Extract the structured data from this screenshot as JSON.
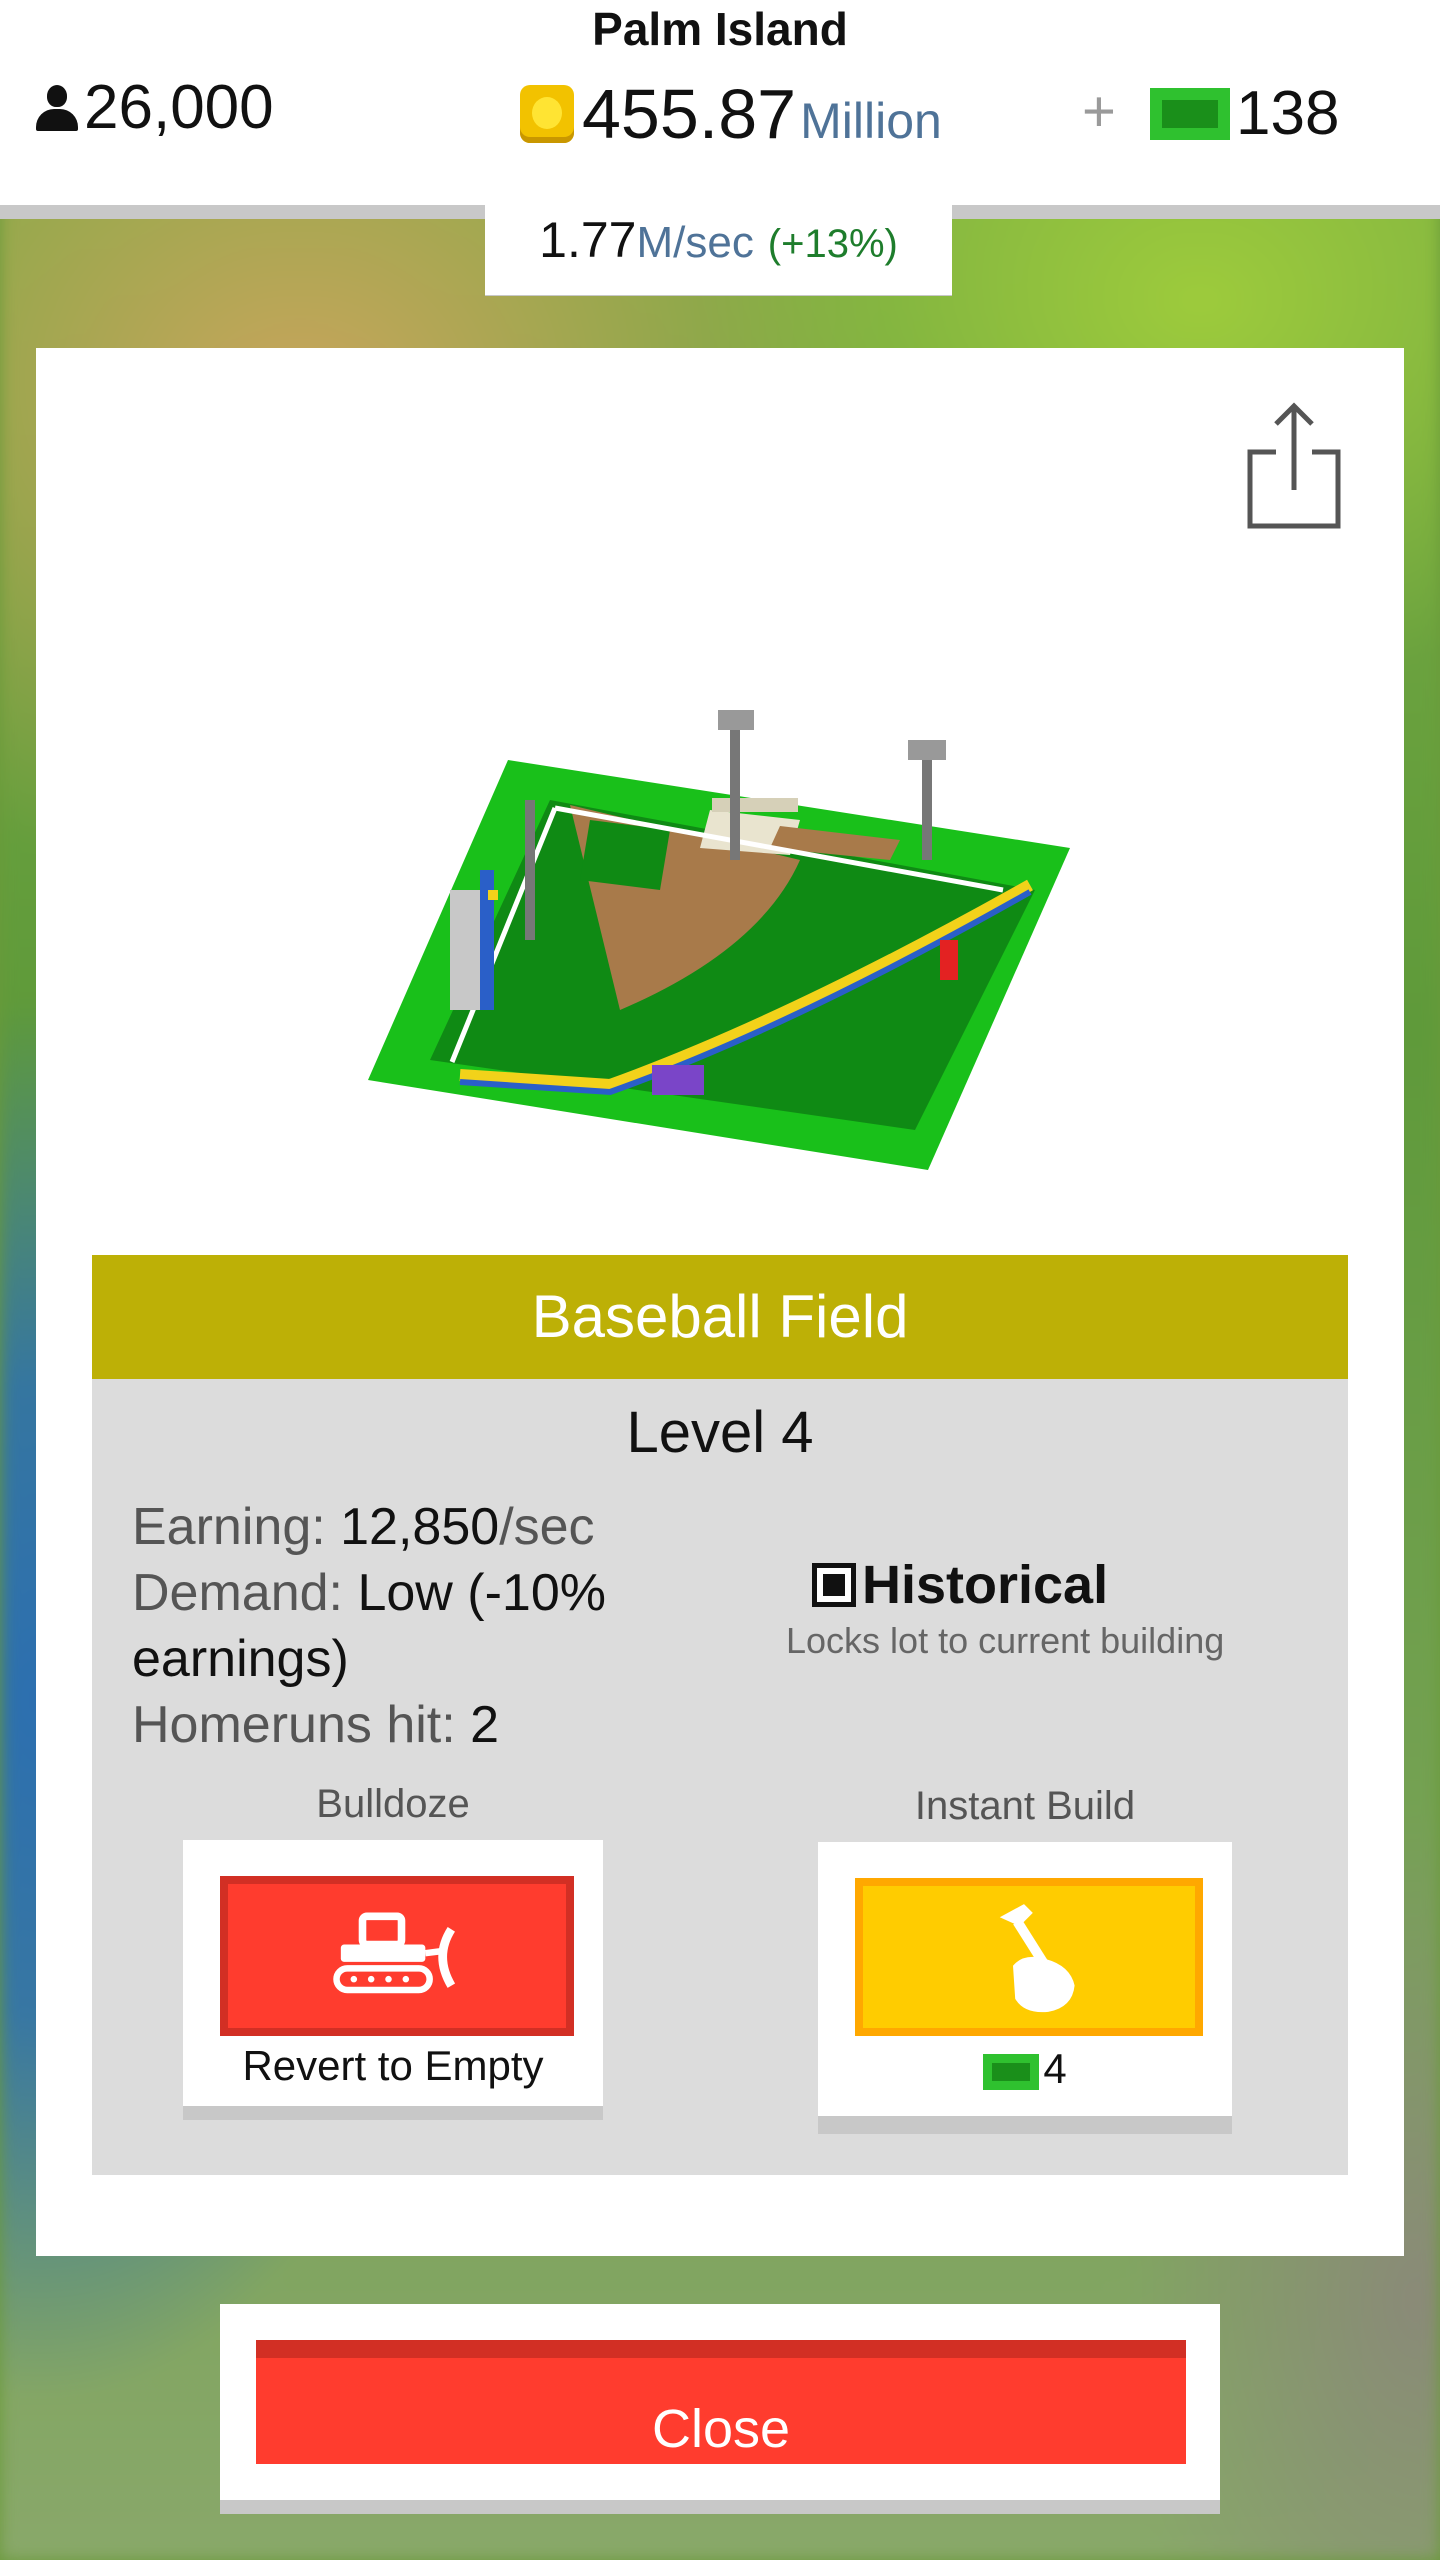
{
  "topbar": {
    "island_name": "Palm Island",
    "population": "26,000",
    "money_value": "455.87",
    "money_unit": "Million",
    "plus": "+",
    "bucks": "138",
    "icons": [
      "person-icon",
      "coin-icon",
      "add-icon",
      "bill-icon"
    ]
  },
  "rate": {
    "value": "1.77",
    "unit": "M/sec",
    "bonus": "(+13%)"
  },
  "building": {
    "name": "Baseball Field",
    "level": "Level 4",
    "earning_label": "Earning: ",
    "earning_value": "12,850",
    "earning_unit": "/sec",
    "demand_label": "Demand: ",
    "demand_value": "Low (-10% earnings)",
    "homeruns_label": "Homeruns hit: ",
    "homeruns_value": "2"
  },
  "historical": {
    "label": "Historical",
    "description": "Locks lot to current building",
    "checked": true
  },
  "bulldoze": {
    "title": "Bulldoze",
    "button_text": "Revert to Empty",
    "icon": "bulldozer-icon"
  },
  "instant_build": {
    "title": "Instant Build",
    "cost": "4",
    "icon": "hammer-hand-icon"
  },
  "close_label": "Close",
  "colors": {
    "header": "#bdb006",
    "close": "#ff3c2e",
    "build": "#ffcc00",
    "money_unit": "#4f7398",
    "bonus": "#1e7d2c"
  }
}
